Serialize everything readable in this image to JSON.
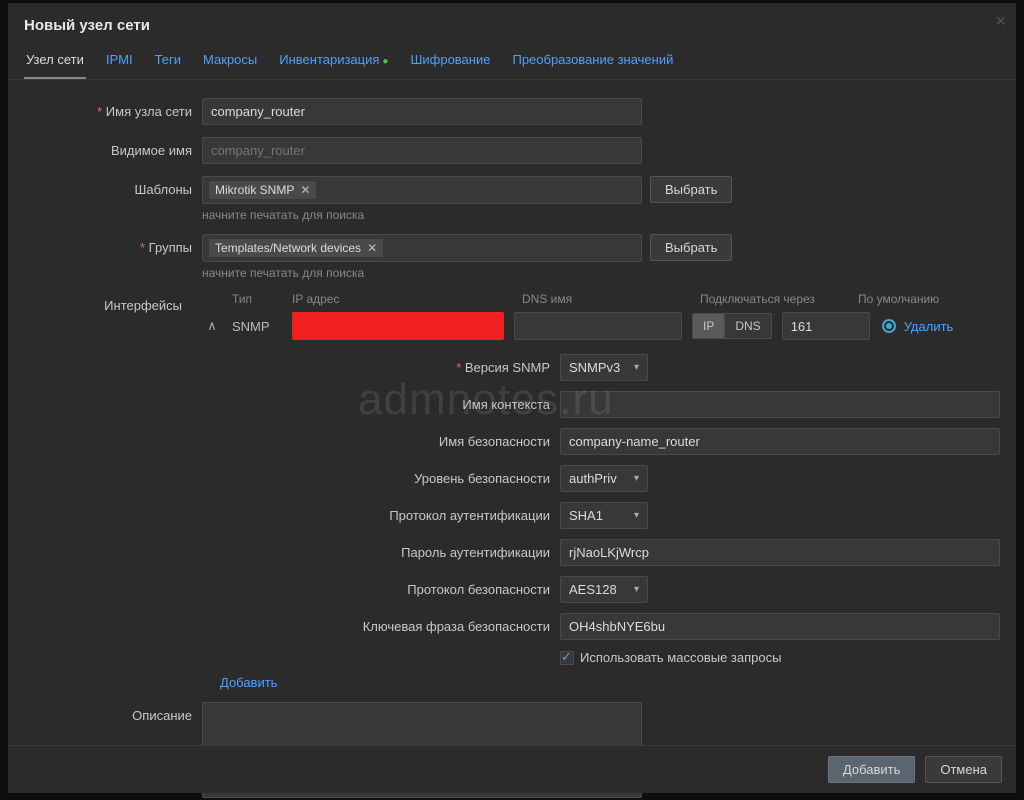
{
  "dialog": {
    "title": "Новый узел сети"
  },
  "tabs": {
    "host": "Узел сети",
    "ipmi": "IPMI",
    "tags": "Теги",
    "macros": "Макросы",
    "inventory": "Инвентаризация",
    "encryption": "Шифрование",
    "valuemap": "Преобразование значений"
  },
  "labels": {
    "hostname": "Имя узла сети",
    "visiblename": "Видимое имя",
    "templates": "Шаблоны",
    "groups": "Группы",
    "interfaces": "Интерфейсы",
    "description": "Описание",
    "select_btn": "Выбрать",
    "search_ph": "начните печатать для поиска",
    "add_link": "Добавить",
    "delete_link": "Удалить"
  },
  "host": {
    "name": "company_router",
    "visible_placeholder": "company_router"
  },
  "templates": {
    "chip": "Mikrotik SNMP"
  },
  "groups": {
    "chip": "Templates/Network devices"
  },
  "iface_head": {
    "type": "Тип",
    "ip": "IP адрес",
    "dns": "DNS имя",
    "connect": "Подключаться через",
    "default": "По умолчанию"
  },
  "iface": {
    "kind": "SNMP",
    "seg_ip": "IP",
    "seg_dns": "DNS",
    "port": "161"
  },
  "snmp": {
    "version_lbl": "Версия SNMP",
    "version": "SNMPv3",
    "context_lbl": "Имя контекста",
    "context": "",
    "secname_lbl": "Имя безопасности",
    "secname": "company-name_router",
    "seclevel_lbl": "Уровень безопасности",
    "seclevel": "authPriv",
    "authproto_lbl": "Протокол аутентификации",
    "authproto": "SHA1",
    "authpass_lbl": "Пароль аутентификации",
    "authpass": "rjNaoLKjWrcp",
    "privproto_lbl": "Протокол безопасности",
    "privproto": "AES128",
    "privpass_lbl": "Ключевая фраза безопасности",
    "privpass": "OH4shbNYE6bu",
    "bulk_lbl": "Использовать массовые запросы"
  },
  "footer": {
    "add": "Добавить",
    "cancel": "Отмена"
  },
  "watermark": "admnotes.ru"
}
